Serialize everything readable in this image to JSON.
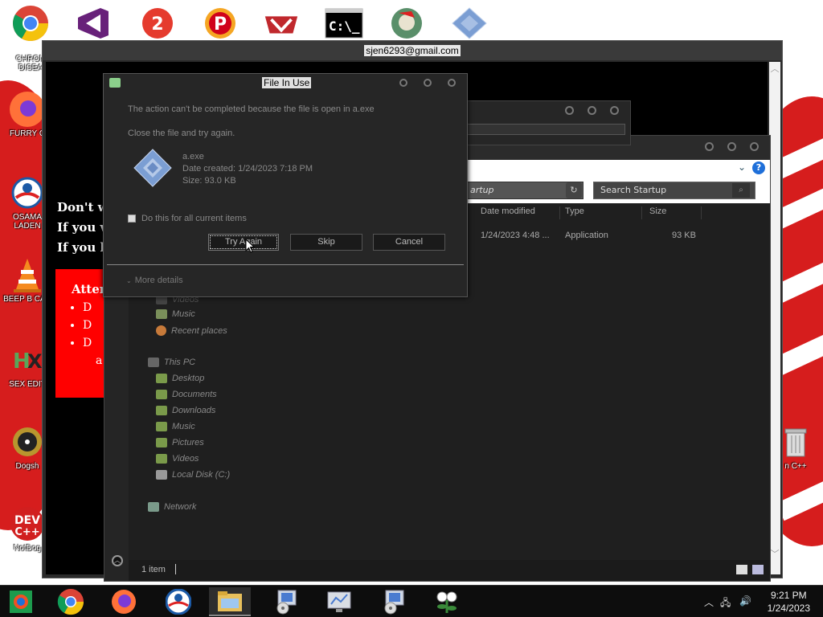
{
  "desktop": {
    "icons": [
      {
        "label": "CHRON DISEA"
      },
      {
        "label": "FURRY C"
      },
      {
        "label": "OSAMA LADEN"
      },
      {
        "label": "BEEP B CAR"
      },
      {
        "label": "SEX EDIT"
      },
      {
        "label": "Dogsh"
      },
      {
        "label": "NotDog"
      }
    ],
    "recycle_label": "n C++"
  },
  "back_window": {
    "title": "sjen6293@gmail.com",
    "lines": [
      "Don't wo",
      "If you w",
      "If you ha"
    ],
    "alert_head": "Atten",
    "bullets": [
      "D",
      "D",
      "D"
    ],
    "bullet_tail": "a"
  },
  "explorer": {
    "address": "artup",
    "search_placeholder": "Search Startup",
    "columns": {
      "date": "Date modified",
      "type": "Type",
      "size": "Size"
    },
    "file": {
      "date": "1/24/2023 4:48 ...",
      "type": "Application",
      "size": "93 KB"
    },
    "nav": {
      "partial_top": "Videos",
      "music1": "Music",
      "recent": "Recent places",
      "this_pc": "This PC",
      "desktop": "Desktop",
      "documents": "Documents",
      "downloads": "Downloads",
      "music2": "Music",
      "pictures": "Pictures",
      "videos": "Videos",
      "local_disk": "Local Disk (C:)",
      "network": "Network"
    },
    "status": "1 item"
  },
  "dialog": {
    "title": "File In Use",
    "message": "The action can't be completed because the file is open in a.exe",
    "instruction": "Close the file and try again.",
    "file_name": "a.exe",
    "date_created": "Date created: 1/24/2023 7:18 PM",
    "size": "Size: 93.0 KB",
    "checkbox_label": "Do this for all current items",
    "buttons": {
      "try_again": "Try Again",
      "skip": "Skip",
      "cancel": "Cancel"
    },
    "more_details": "More details"
  },
  "taskbar": {
    "time": "9:21 PM",
    "date": "1/24/2023"
  },
  "colors": {
    "accent_red": "#d61d1d",
    "alert_red": "#ff0000",
    "dark_bg": "#1f1f1f"
  }
}
